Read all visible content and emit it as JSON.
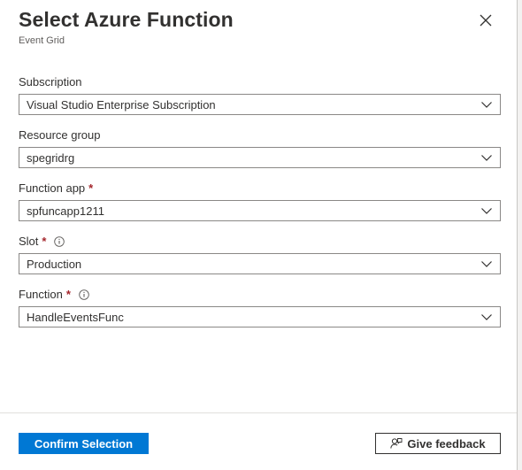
{
  "header": {
    "title": "Select Azure Function",
    "subtitle": "Event Grid",
    "close_icon": "close-icon"
  },
  "fields": [
    {
      "label": "Subscription",
      "required": false,
      "info": false,
      "value": "Visual Studio Enterprise Subscription"
    },
    {
      "label": "Resource group",
      "required": false,
      "info": false,
      "value": "spegridrg"
    },
    {
      "label": "Function app",
      "required": true,
      "info": false,
      "value": "spfuncapp1211"
    },
    {
      "label": "Slot",
      "required": true,
      "info": true,
      "value": "Production"
    },
    {
      "label": "Function",
      "required": true,
      "info": true,
      "value": "HandleEventsFunc"
    }
  ],
  "required_marker": "*",
  "footer": {
    "confirm_label": "Confirm Selection",
    "feedback_label": "Give feedback",
    "feedback_icon": "feedback-person-icon"
  },
  "colors": {
    "primary": "#0078d4",
    "required": "#a4262c",
    "text": "#323130",
    "subtle_text": "#605e5c",
    "border": "#8a8886"
  }
}
